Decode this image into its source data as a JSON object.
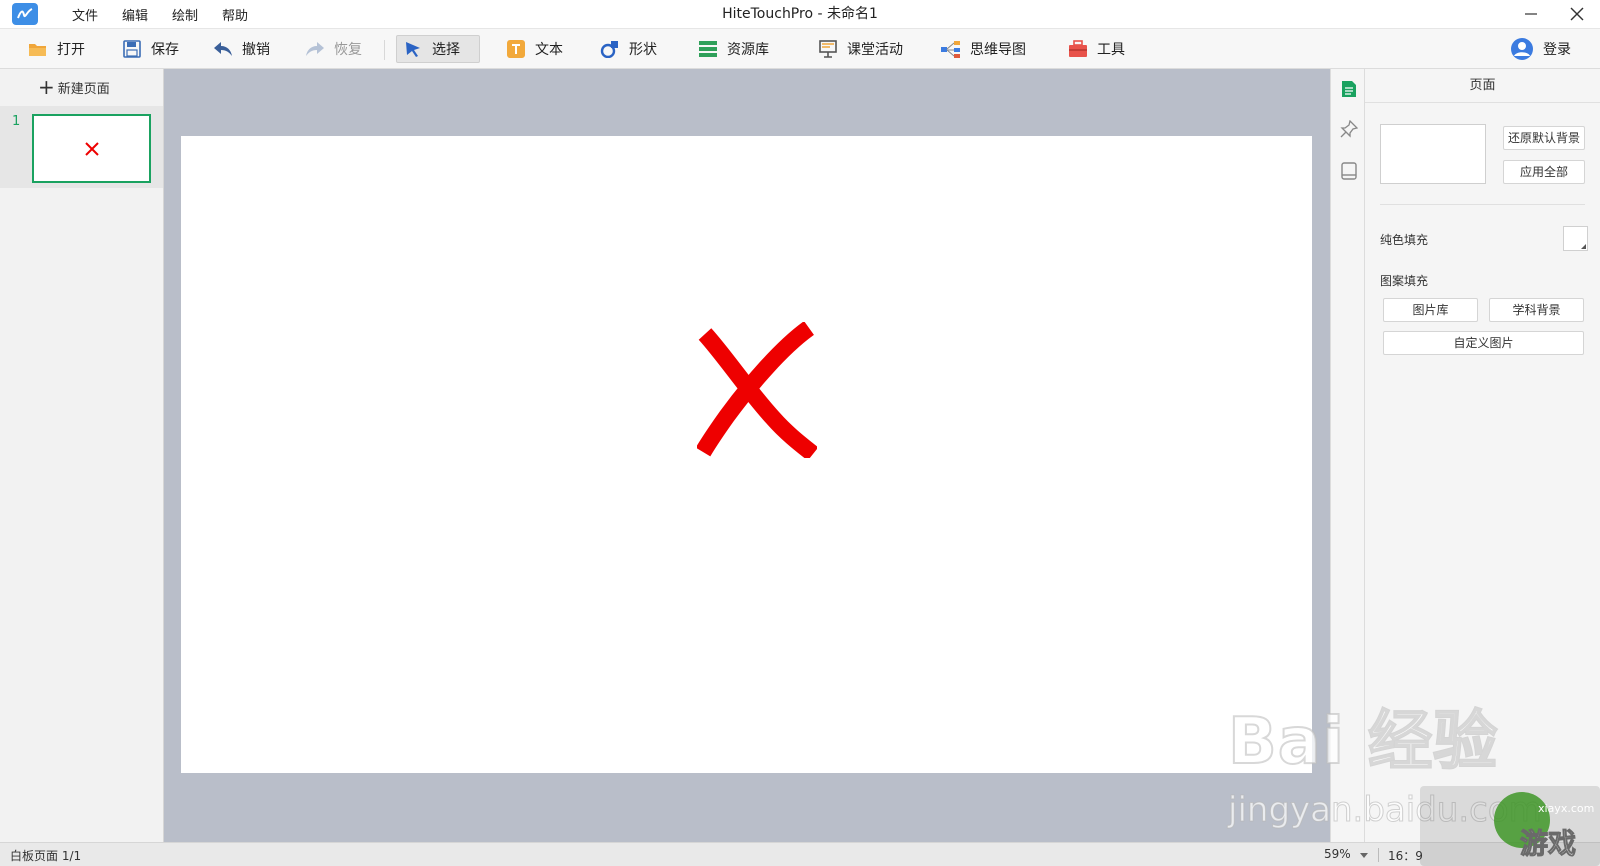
{
  "window": {
    "title": "HiteTouchPro - 未命名1",
    "menu": [
      "文件",
      "编辑",
      "绘制",
      "帮助"
    ]
  },
  "toolbar": {
    "open": "打开",
    "save": "保存",
    "undo": "撤销",
    "redo": "恢复",
    "select": "选择",
    "text": "文本",
    "shape": "形状",
    "resources": "资源库",
    "class_activity": "课堂活动",
    "mindmap": "思维导图",
    "tools": "工具",
    "login": "登录"
  },
  "pages": {
    "new_page_label": "新建页面",
    "items": [
      {
        "number": "1",
        "selected": true
      }
    ]
  },
  "properties": {
    "title": "页面",
    "restore_default_bg": "还原默认背景",
    "apply_all": "应用全部",
    "solid_fill_label": "纯色填充",
    "solid_fill_color": "#ffffff",
    "pattern_fill_label": "图案填充",
    "image_library": "图片库",
    "subject_background": "学科背景",
    "custom_image": "自定义图片"
  },
  "status": {
    "page_info": "白板页面 1/1",
    "zoom": "59%",
    "ratio": "16：9"
  },
  "colors": {
    "accent_green": "#1aa260",
    "cross_red": "#ee0000",
    "canvas_bg": "#b9bec9"
  },
  "icons": {
    "strip": [
      "page-icon",
      "pin-icon",
      "tablet-icon"
    ]
  },
  "watermark": {
    "baidu": "Bai 经验",
    "jingyan": "jingyan.baidu.com",
    "corner_text": "游戏",
    "corner_site": "xiayx.com"
  }
}
